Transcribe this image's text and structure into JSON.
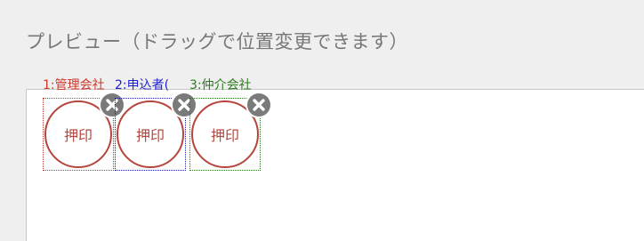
{
  "heading": "プレビュー（ドラッグで位置変更できます）",
  "stamps": [
    {
      "label": "1:管理会社",
      "color": "#d2372b",
      "text": "押印"
    },
    {
      "label": "2:申込者(",
      "color": "#1f1fd0",
      "text": "押印"
    },
    {
      "label": "3:仲介会社",
      "color": "#2c7a1f",
      "text": "押印"
    }
  ],
  "close_icon": "circle-x-icon"
}
